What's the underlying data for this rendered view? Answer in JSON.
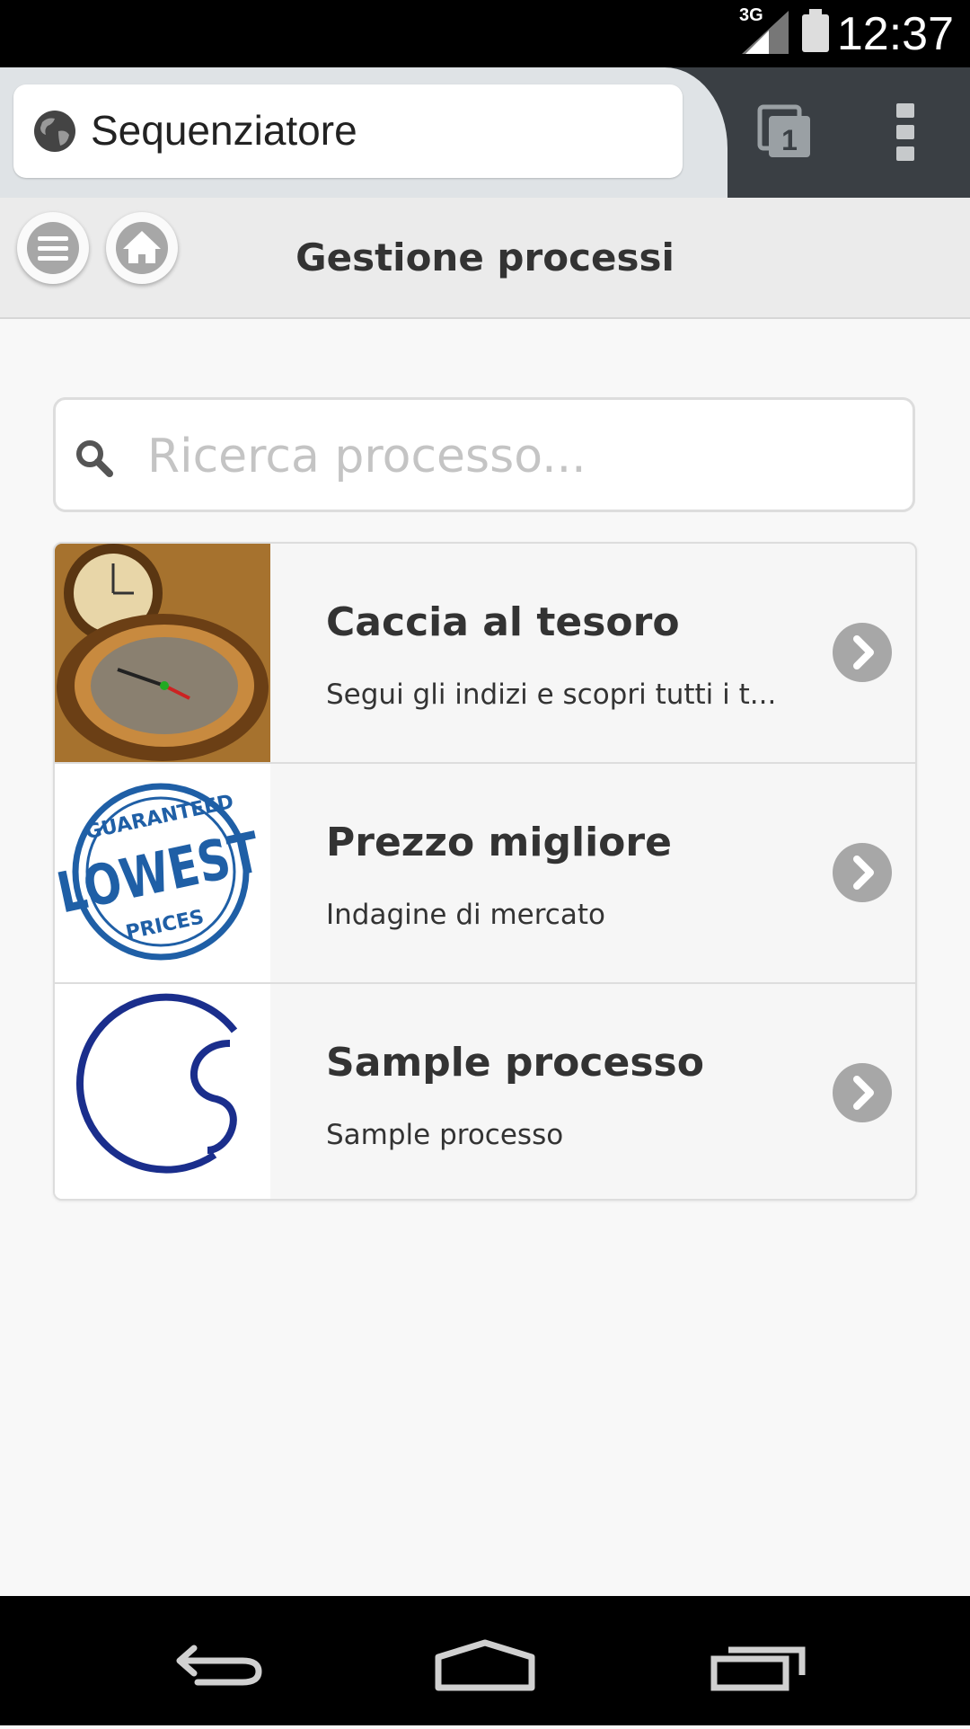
{
  "status_bar": {
    "time": "12:37",
    "network": "3G"
  },
  "browser": {
    "url_title": "Sequenziatore",
    "tab_count": "1"
  },
  "header": {
    "title": "Gestione processi"
  },
  "search": {
    "placeholder": "Ricerca processo..."
  },
  "items": [
    {
      "title": "Caccia al tesoro",
      "subtitle": "Segui gli indizi e scopri tutti i t..."
    },
    {
      "title": "Prezzo migliore",
      "subtitle": "Indagine di mercato"
    },
    {
      "title": "Sample processo",
      "subtitle": "Sample processo"
    }
  ],
  "thumbnail_texts": {
    "lowest_top": "GUARANTEED",
    "lowest_main": "LOWEST",
    "lowest_bottom": "PRICES"
  },
  "colors": {
    "accent_blue": "#1f5fa6",
    "logo_navy": "#1a2e8c"
  }
}
